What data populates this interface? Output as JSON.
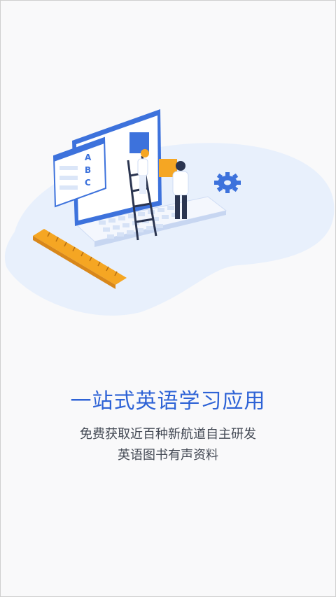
{
  "onboarding": {
    "headline": "一站式英语学习应用",
    "subtitle_line1": "免费获取近百种新航道自主研发",
    "subtitle_line2": "英语图书有声资料",
    "illustration": {
      "card_letters": [
        "A",
        "B",
        "C"
      ],
      "icons": [
        "gear-icon",
        "ruler-icon",
        "laptop-icon",
        "ladder-icon",
        "person-icon",
        "document-card-icon"
      ]
    }
  },
  "colors": {
    "accent": "#2e63d6",
    "text": "#444a55",
    "ruler": "#f5a623",
    "backdrop": "#e8f0fc"
  }
}
